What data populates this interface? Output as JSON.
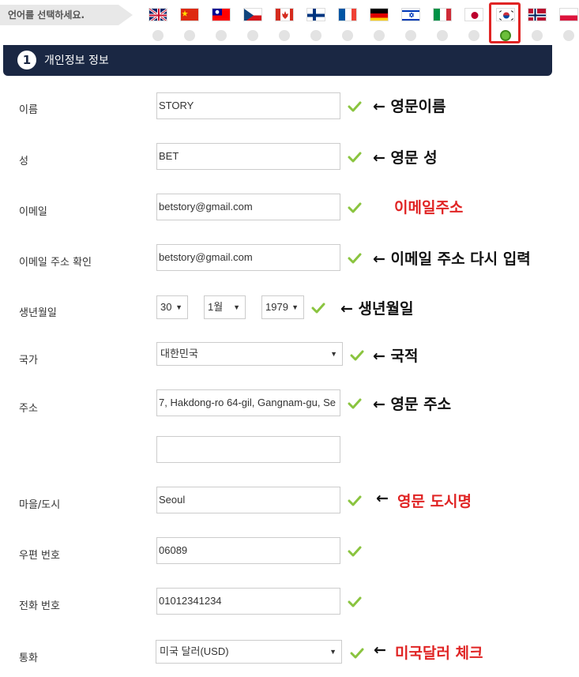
{
  "language_bar": {
    "label": "언어를 선택하세요.",
    "flags": [
      {
        "name": "uk-flag-icon"
      },
      {
        "name": "china-flag-icon"
      },
      {
        "name": "taiwan-flag-icon"
      },
      {
        "name": "czech-flag-icon"
      },
      {
        "name": "canada-flag-icon"
      },
      {
        "name": "finland-flag-icon"
      },
      {
        "name": "france-flag-icon"
      },
      {
        "name": "germany-flag-icon"
      },
      {
        "name": "israel-flag-icon"
      },
      {
        "name": "italy-flag-icon"
      },
      {
        "name": "japan-flag-icon"
      },
      {
        "name": "korea-flag-icon"
      },
      {
        "name": "norway-flag-icon"
      },
      {
        "name": "poland-flag-icon"
      }
    ],
    "selected": "korea-flag-icon"
  },
  "section": {
    "number": "1",
    "title": "개인정보 정보"
  },
  "form": {
    "first_name": {
      "label": "이름",
      "value": "STORY",
      "annotation": "← 영문이름"
    },
    "last_name": {
      "label": "성",
      "value": "BET",
      "annotation": "← 영문 성"
    },
    "email": {
      "label": "이메일",
      "value": "betstory@gmail.com",
      "annotation": "이메일주소"
    },
    "email_confirm": {
      "label": "이메일 주소 확인",
      "value": "betstory@gmail.com",
      "annotation": "← 이메일 주소 다시 입력"
    },
    "birthdate": {
      "label": "생년월일",
      "day": "30",
      "month": "1월",
      "year": "1979",
      "annotation": "← 생년월일"
    },
    "country": {
      "label": "국가",
      "value": "대한민국",
      "annotation": "← 국적"
    },
    "address": {
      "label": "주소",
      "value": "7, Hakdong-ro 64-gil, Gangnam-gu, Se",
      "value2": "",
      "annotation": "← 영문 주소"
    },
    "city": {
      "label": "마을/도시",
      "value": "Seoul",
      "annotation_arrow": "←",
      "annotation": "영문 도시명"
    },
    "postal": {
      "label": "우편 번호",
      "value": "06089"
    },
    "phone": {
      "label": "전화 번호",
      "value": "01012341234"
    },
    "currency": {
      "label": "통화",
      "value": "미국 달러(USD)",
      "annotation_arrow": "←",
      "annotation": "미국달러 체크"
    }
  },
  "colors": {
    "header_bg": "#1a2743",
    "check": "#8ac43f",
    "highlight": "#e02424",
    "accent_red": "#e02424"
  },
  "caret_icon": "▼"
}
